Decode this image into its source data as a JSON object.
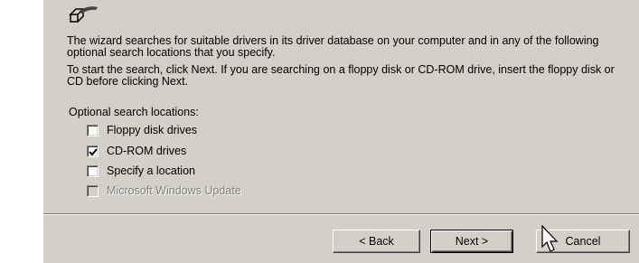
{
  "intro": {
    "line1": "The wizard searches for suitable drivers in its driver database on your computer and in any of the following optional search locations that you specify.",
    "line2": "To start the search, click Next. If you are searching on a floppy disk or CD-ROM drive, insert the floppy disk or CD before clicking Next."
  },
  "options": {
    "heading": "Optional search locations:",
    "items": [
      {
        "label": "Floppy disk drives",
        "checked": false,
        "enabled": true
      },
      {
        "label": "CD-ROM drives",
        "checked": true,
        "enabled": true
      },
      {
        "label": "Specify a location",
        "checked": false,
        "enabled": true
      },
      {
        "label": "Microsoft Windows Update",
        "checked": false,
        "enabled": false
      }
    ]
  },
  "buttons": {
    "back": "< Back",
    "next": "Next >",
    "cancel": "Cancel"
  },
  "icons": {
    "header": "wizard-hardware-icon",
    "cursor": "mouse-pointer-icon"
  }
}
